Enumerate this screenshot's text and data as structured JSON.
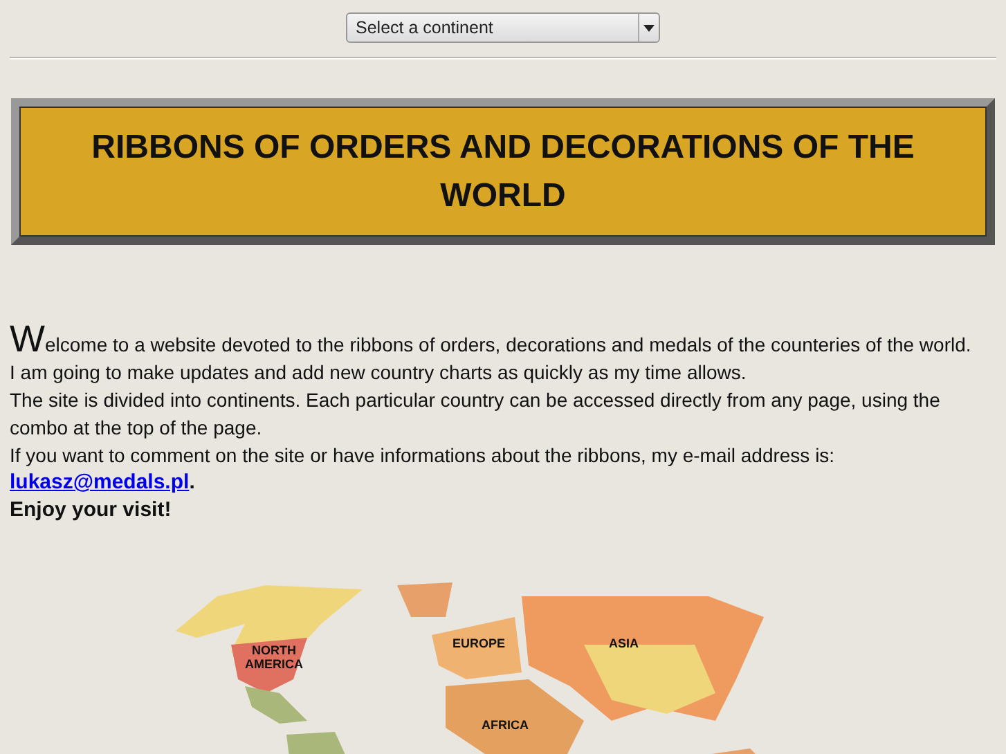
{
  "continent_select": {
    "value": "Select a continent"
  },
  "title": "RIBBONS OF ORDERS AND DECORATIONS OF THE WORLD",
  "intro": {
    "initial": "W",
    "lead": "elcome to a website devoted to the ribbons of orders, decorations and medals of the counteries of the world."
  },
  "paragraphs": [
    "I am going to make updates and add new country charts as quickly as my time allows.",
    "The site is divided into continents. Each particular country can be accessed directly from any page, using the combo at the top of the page.",
    "If you want to comment on the site or have informations about the ribbons, my e-mail address is:"
  ],
  "email": {
    "link": "lukasz@medals.pl",
    "after": "."
  },
  "closing": "Enjoy your visit!",
  "map": {
    "labels": [
      "NORTH\nAMERICA",
      "EUROPE",
      "ASIA",
      "AFRICA"
    ]
  }
}
